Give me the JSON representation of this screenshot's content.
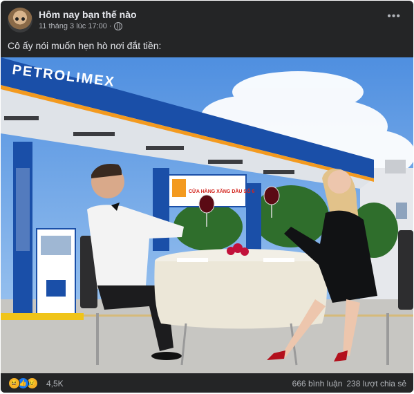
{
  "post": {
    "author": "Hôm nay bạn thế nào",
    "timestamp": "11 tháng 3 lúc 17:00",
    "separator": "·",
    "privacy_icon": "globe-icon",
    "more_label": "•••",
    "caption": "Cô ấy nói muốn hẹn hò nơi đắt tiền:"
  },
  "photo": {
    "canopy_brand": "PETROLIMEX",
    "sign_text": "CỬA HÀNG XĂNG DẦU SỐ 6"
  },
  "footer": {
    "reaction_icons": [
      "haha-icon",
      "like-icon",
      "sad-icon"
    ],
    "reaction_count": "4,5K",
    "comments": "666 bình luận",
    "shares": "238 lượt chia sẻ"
  },
  "colors": {
    "card_bg": "#242526",
    "text_primary": "#e4e6eb",
    "text_secondary": "#b0b3b8",
    "petrolimex_blue": "#1a4fa8",
    "petrolimex_orange": "#f39a1f"
  }
}
